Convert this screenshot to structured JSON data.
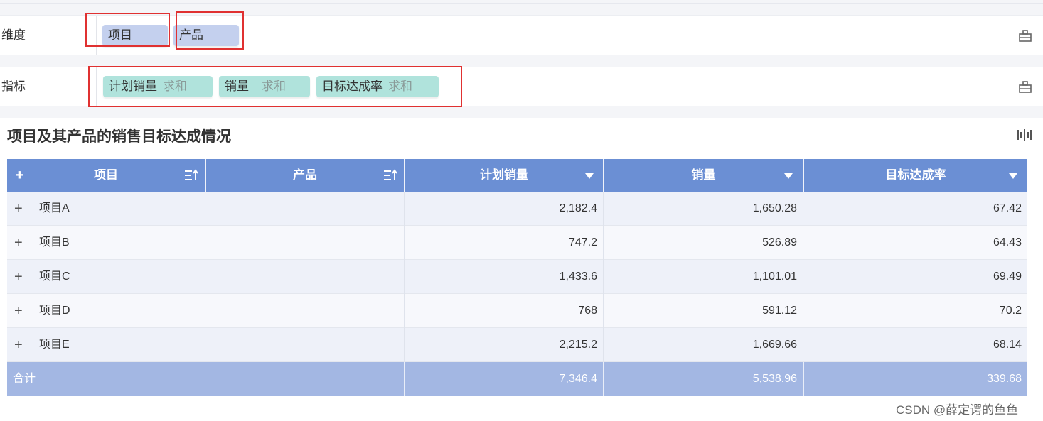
{
  "fields": {
    "dimension": {
      "label": "维度",
      "pills": [
        {
          "name": "项目"
        },
        {
          "name": "产品"
        }
      ]
    },
    "metric": {
      "label": "指标",
      "pills": [
        {
          "name": "计划销量",
          "agg": "求和"
        },
        {
          "name": "销量",
          "agg": "求和"
        },
        {
          "name": "目标达成率",
          "agg": "求和"
        }
      ]
    },
    "settings_icon": "settings-icon"
  },
  "table": {
    "title": "项目及其产品的销售目标达成情况",
    "expand_all": "+",
    "columns": [
      "项目",
      "产品",
      "计划销量",
      "销量",
      "目标达成率"
    ],
    "rows": [
      {
        "project": "项目A",
        "product": "",
        "planned": "2,182.4",
        "sales": "1,650.28",
        "rate": "67.42"
      },
      {
        "project": "项目B",
        "product": "",
        "planned": "747.2",
        "sales": "526.89",
        "rate": "64.43"
      },
      {
        "project": "项目C",
        "product": "",
        "planned": "1,433.6",
        "sales": "1,101.01",
        "rate": "69.49"
      },
      {
        "project": "项目D",
        "product": "",
        "planned": "768",
        "sales": "591.12",
        "rate": "70.2"
      },
      {
        "project": "项目E",
        "product": "",
        "planned": "2,215.2",
        "sales": "1,669.66",
        "rate": "68.14"
      }
    ],
    "row_expand": "+",
    "total": {
      "label": "合计",
      "planned": "7,346.4",
      "sales": "5,538.96",
      "rate": "339.68"
    }
  },
  "colors": {
    "header_bg": "#6b8fd4",
    "total_bg": "#a3b7e3",
    "dim_pill": "#c4d0ee",
    "metric_pill": "#b0e3dc",
    "highlight": "#e03131"
  },
  "watermark": "CSDN @薛定谔的鱼鱼"
}
